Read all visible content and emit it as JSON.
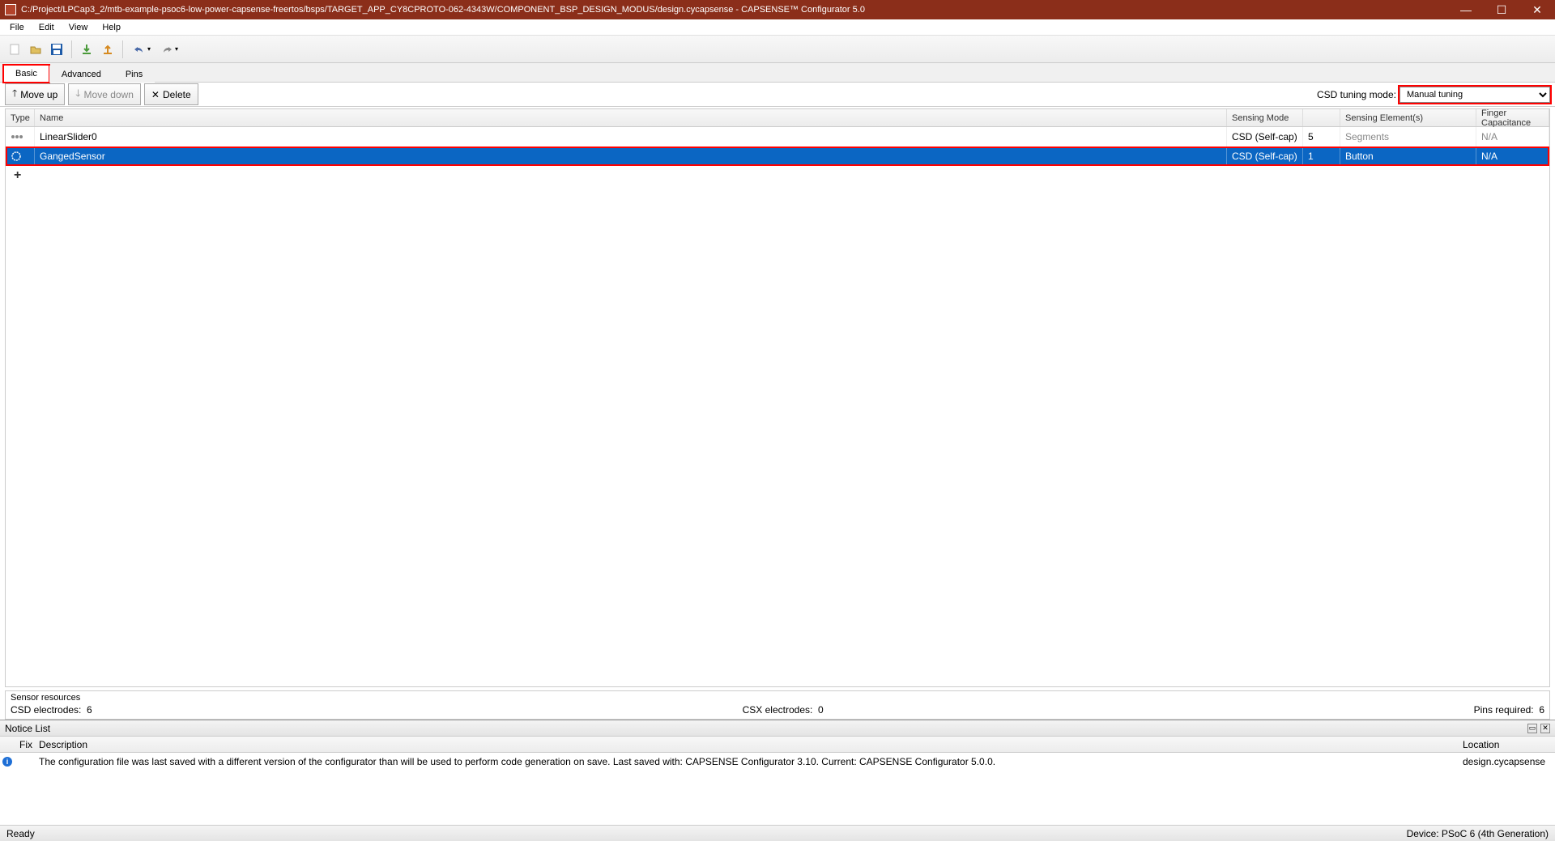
{
  "window": {
    "title": "C:/Project/LPCap3_2/mtb-example-psoc6-low-power-capsense-freertos/bsps/TARGET_APP_CY8CPROTO-062-4343W/COMPONENT_BSP_DESIGN_MODUS/design.cycapsense - CAPSENSE™ Configurator 5.0"
  },
  "menu": {
    "file": "File",
    "edit": "Edit",
    "view": "View",
    "help": "Help"
  },
  "tabs": {
    "basic": "Basic",
    "advanced": "Advanced",
    "pins": "Pins"
  },
  "actions": {
    "moveup": "Move up",
    "movedown": "Move down",
    "delete": "Delete"
  },
  "tuning": {
    "label": "CSD tuning mode:",
    "value": "Manual tuning"
  },
  "grid": {
    "headers": {
      "type": "Type",
      "name": "Name",
      "mode": "Sensing Mode",
      "elements": "Sensing Element(s)",
      "fc": "Finger Capacitance"
    },
    "rows": [
      {
        "name": "LinearSlider0",
        "mode": "CSD (Self-cap)",
        "count": "5",
        "elem": "Segments",
        "fc": "N/A",
        "selected": false,
        "highlight": false,
        "elem_faint": true,
        "fc_faint": true
      },
      {
        "name": "GangedSensor",
        "mode": "CSD (Self-cap)",
        "count": "1",
        "elem": "Button",
        "fc": "N/A",
        "selected": true,
        "highlight": true,
        "elem_faint": false,
        "fc_faint": false
      }
    ]
  },
  "sensor": {
    "title": "Sensor resources",
    "csd_label": "CSD electrodes:",
    "csd_val": "6",
    "csx_label": "CSX electrodes:",
    "csx_val": "0",
    "pins_label": "Pins required:",
    "pins_val": "6"
  },
  "notice": {
    "title": "Notice List",
    "headers": {
      "fix": "Fix",
      "desc": "Description",
      "loc": "Location"
    },
    "items": [
      {
        "type": "info",
        "desc": "The configuration file was last saved with a different version of the configurator than will be used to perform code generation on save. Last saved with: CAPSENSE Configurator 3.10. Current: CAPSENSE Configurator 5.0.0.",
        "loc": "design.cycapsense"
      }
    ]
  },
  "status": {
    "left": "Ready",
    "right": "Device: PSoC 6 (4th Generation)"
  }
}
